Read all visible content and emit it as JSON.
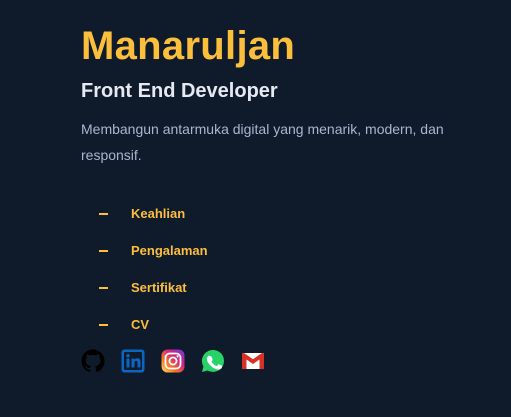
{
  "hero": {
    "name": "Manaruljan",
    "role": "Front End Developer",
    "description": "Membangun antarmuka digital yang menarik, modern, dan responsif."
  },
  "nav": {
    "items": [
      {
        "label": "Keahlian"
      },
      {
        "label": "Pengalaman"
      },
      {
        "label": "Sertifikat"
      },
      {
        "label": "CV"
      }
    ]
  },
  "socials": [
    {
      "icon": "github-icon"
    },
    {
      "icon": "linkedin-icon"
    },
    {
      "icon": "instagram-icon"
    },
    {
      "icon": "whatsapp-icon"
    },
    {
      "icon": "gmail-icon"
    }
  ],
  "colors": {
    "background": "#0f1a2b",
    "accent": "#fbbf3b",
    "heading": "#e6e9ef",
    "body_text": "#aab6d0"
  }
}
